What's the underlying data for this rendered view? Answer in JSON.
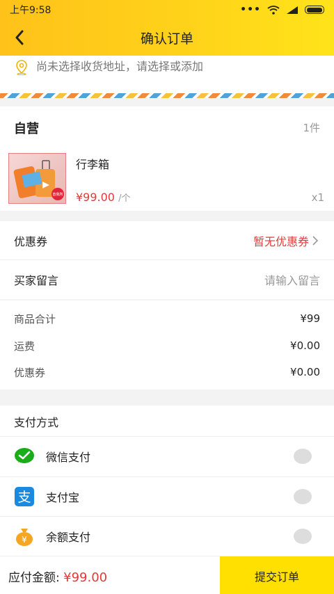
{
  "status_bar": {
    "time": "上午9:58",
    "dots": "•••"
  },
  "nav": {
    "title": "确认订单"
  },
  "address": {
    "text": "尚未选择收货地址，请选择或添加"
  },
  "shop": {
    "name": "自营",
    "count": "1件",
    "product": {
      "name": "行李箱",
      "price": "¥99.00",
      "unit": "/个",
      "qty": "x1",
      "badge": "皆我所"
    }
  },
  "coupon": {
    "label": "优惠券",
    "value": "暂无优惠券"
  },
  "message": {
    "label": "买家留言",
    "placeholder": "请输入留言"
  },
  "summary": [
    {
      "label": "商品合计",
      "value": "¥99"
    },
    {
      "label": "运费",
      "value": "¥0.00"
    },
    {
      "label": "优惠券",
      "value": "¥0.00"
    }
  ],
  "payment": {
    "title": "支付方式",
    "methods": [
      {
        "label": "微信支付",
        "icon": "wechat-pay-icon",
        "color": "#1aad19"
      },
      {
        "label": "支付宝",
        "icon": "alipay-icon",
        "color": "#1a8ae0"
      },
      {
        "label": "余额支付",
        "icon": "balance-bag-icon",
        "color": "#f5a623"
      }
    ]
  },
  "footer": {
    "total_label": "应付金额:",
    "total_value": "¥99.00",
    "submit_label": "提交订单"
  },
  "colors": {
    "accent": "#ffd21a",
    "price": "#e23a3a",
    "submit": "#ffe000"
  }
}
